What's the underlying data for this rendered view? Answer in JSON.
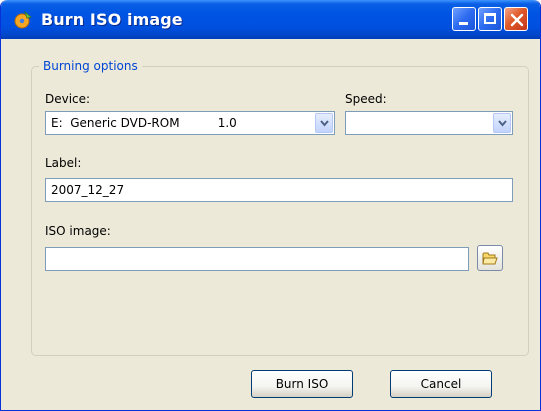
{
  "window": {
    "title": "Burn ISO image",
    "icons": {
      "app": "burn-app-icon",
      "minimize": "minimize-icon",
      "maximize": "maximize-icon",
      "close": "close-icon"
    },
    "colors": {
      "titlebar": "#0054E3",
      "face": "#ECE9D8",
      "group_legend": "#0046D5",
      "close": "#E15A2A"
    }
  },
  "burning_options": {
    "legend": "Burning options",
    "device": {
      "label": "Device:",
      "value": "E:  Generic DVD-ROM          1.0"
    },
    "speed": {
      "label": "Speed:",
      "value": ""
    },
    "label_field": {
      "label": "Label:",
      "value": "2007_12_27"
    },
    "iso_image": {
      "label": "ISO image:",
      "value": "",
      "browse_icon": "folder-open-icon"
    }
  },
  "buttons": {
    "burn": "Burn ISO",
    "cancel": "Cancel"
  }
}
